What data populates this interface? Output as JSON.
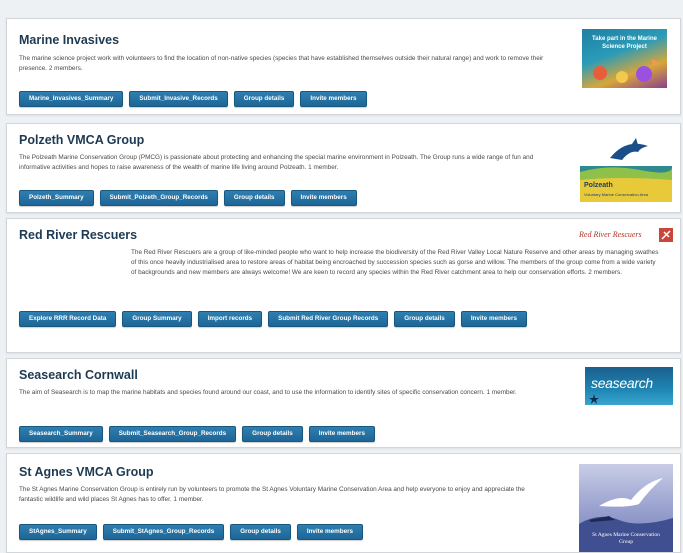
{
  "groups": [
    {
      "name": "Marine Invasives",
      "description": "The marine science project work with volunteers to find the location of non-native species (species that have established themselves outside their natural range) and work to remove their presence. 2 members.",
      "buttons": [
        "Marine_Invasives_Summary",
        "Submit_Invasive_Records",
        "Group details",
        "Invite members"
      ],
      "logo_text": "Take part in the Marine Science Project"
    },
    {
      "name": "Polzeth VMCA Group",
      "description": "The Polzeath Marine Conservation Group (PMCG) is passionate about protecting and enhancing the special marine environment in Polzeath. The Group runs a wide range of fun and informative activities and hopes to raise awareness of the wealth of marine life living around Polzeath. 1 member.",
      "buttons": [
        "Polzeth_Summary",
        "Submit_Polzeth_Group_Records",
        "Group details",
        "Invite members"
      ],
      "logo_text": "Polzeath",
      "logo_subtext": "Voluntary Marine Conservation Area"
    },
    {
      "name": "Red River Rescuers",
      "description": "The Red River Rescuers are a group of like-minded people who want to help increase the biodiversity of the Red River Valley Local Nature Reserve and other areas by managing swathes of this once heavily industrialised area to restore areas of habitat being encroached by succession species such as gorse and willow. The members of the group come from a wide variety of backgrounds and new members are always welcome! We are keen to record any species within the Red River catchment area to help our conservation efforts. 2 members.",
      "buttons": [
        "Explore RRR Record Data",
        "Group Summary",
        "Import records",
        "Submit Red River Group Records",
        "Group details",
        "Invite members"
      ],
      "logo_text": "Red River Rescuers"
    },
    {
      "name": "Seasearch Cornwall",
      "description": "The aim of Seasearch is to map the marine habitats and species found around our coast, and to use the information to identify sites of specific conservation concern. 1 member.",
      "buttons": [
        "Seasearch_Summary",
        "Submit_Seasearch_Group_Records",
        "Group details",
        "Invite members"
      ],
      "logo_text": "seasearch"
    },
    {
      "name": "St Agnes VMCA Group",
      "description": "The St Agnes Marine Conservation Group is entirely run by volunteers to promote the St Agnes Voluntary Marine Conservation Area and help everyone to enjoy and appreciate the fantastic wildlife and wild places St Agnes has to offer. 1 member.",
      "buttons": [
        "StAgnes_Summary",
        "Submit_StAgnes_Group_Records",
        "Group details",
        "Invite members"
      ],
      "logo_text": "St Agnes Marine Conservation Group"
    }
  ],
  "colors": {
    "title": "#1e3a52",
    "button": "#1d6697",
    "card_bg": "#ffffff",
    "page_bg": "#eef1f3"
  }
}
